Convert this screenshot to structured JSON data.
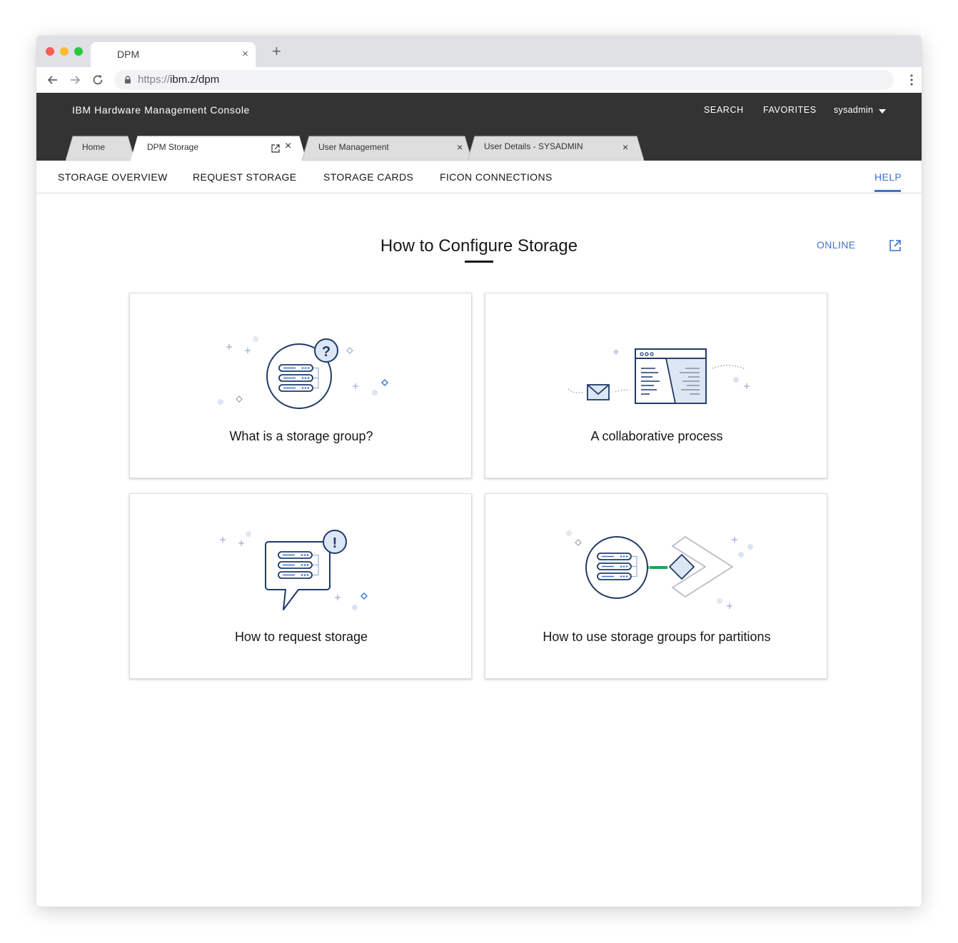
{
  "browser": {
    "tab_title": "DPM",
    "tab_close": "×",
    "new_tab": "+",
    "url_scheme": "https://",
    "url_host": "ibm.z/dpm"
  },
  "app": {
    "title": "IBM Hardware Management Console",
    "search": "SEARCH",
    "favorites": "FAVORITES",
    "user": "sysadmin"
  },
  "tabs": [
    {
      "label": "Home"
    },
    {
      "label": "DPM Storage"
    },
    {
      "label": "User Management"
    },
    {
      "label": "User Details -  SYSADMIN"
    }
  ],
  "tab_close": "×",
  "subnav": {
    "items": [
      "STORAGE OVERVIEW",
      "REQUEST STORAGE",
      "STORAGE CARDS",
      "FICON CONNECTIONS"
    ],
    "help": "HELP"
  },
  "main": {
    "title": "How to Configure Storage",
    "online": "ONLINE",
    "cards": [
      {
        "label": "What is a storage group?",
        "icon": "storage-group-question-icon"
      },
      {
        "label": "A collaborative process",
        "icon": "collaborative-document-icon"
      },
      {
        "label": "How to request storage",
        "icon": "storage-request-bubble-icon"
      },
      {
        "label": "How to use storage groups for partitions",
        "icon": "storage-partition-connection-icon"
      }
    ],
    "glyphs": {
      "question": "?",
      "exclaim": "!"
    }
  },
  "colors": {
    "header_bg": "#333333",
    "accent": "#3b73cf",
    "illustration_stroke": "#1f3a68",
    "illustration_fill": "#dde6f4",
    "connector_green": "#1aa35c"
  }
}
